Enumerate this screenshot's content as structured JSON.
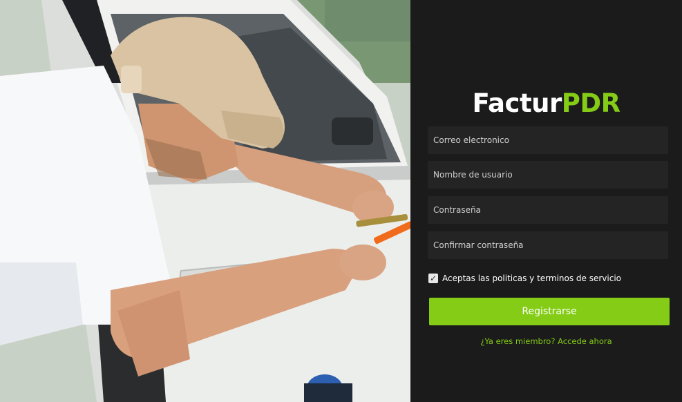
{
  "brand": {
    "prefix": "Factur",
    "suffix": "PDR",
    "accent_color": "#84cc16"
  },
  "form": {
    "email_placeholder": "Correo electronico",
    "username_placeholder": "Nombre de usuario",
    "password_placeholder": "Contraseña",
    "confirm_password_placeholder": "Confirmar contraseña",
    "terms_label": "Aceptas las politicas y terminos de servicio",
    "terms_checked": true,
    "terms_check_glyph": "✓",
    "submit_label": "Registrarse",
    "login_link": "¿Ya eres miembro? Accede ahora"
  },
  "hero_image": {
    "subject": "technician repairing a dent on a white car door"
  }
}
